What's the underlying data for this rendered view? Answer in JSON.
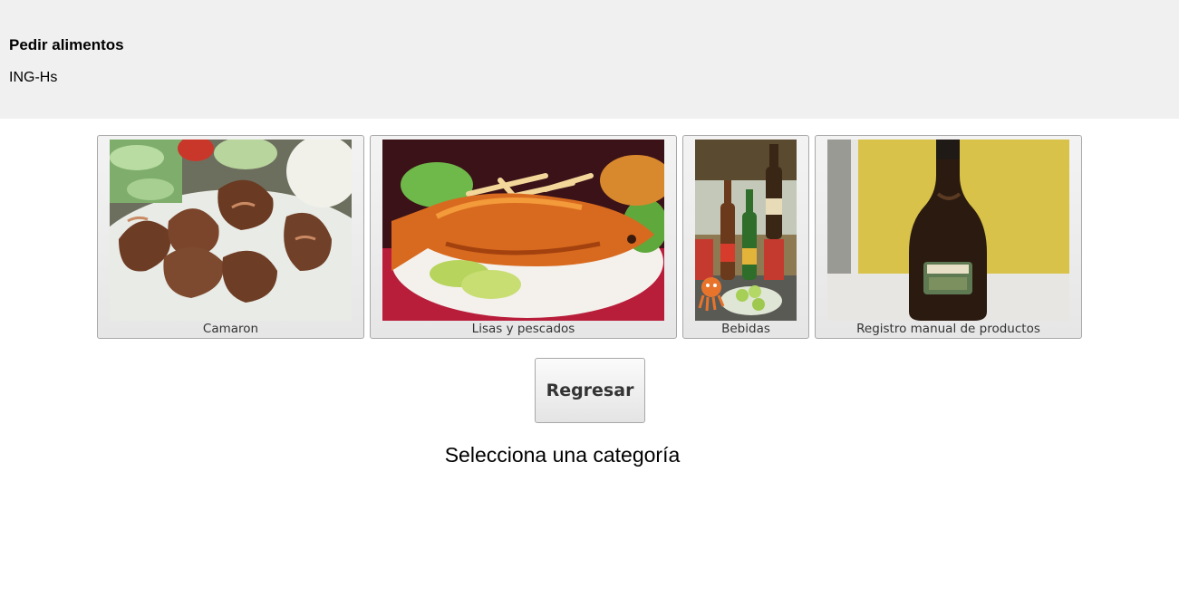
{
  "header": {
    "title": "Pedir alimentos",
    "subtitle": "ING-Hs"
  },
  "categories": [
    {
      "label": "Camaron",
      "image": "grilled-shrimp-plate"
    },
    {
      "label": "Lisas y pescados",
      "image": "fried-fish-plate"
    },
    {
      "label": "Bebidas",
      "image": "beer-bottles-and-limes"
    },
    {
      "label": "Registro manual de productos",
      "image": "baileys-bottle"
    }
  ],
  "actions": {
    "back_label": "Regresar"
  },
  "prompt": "Selecciona una categoría",
  "colors": {
    "header_bg": "#f0f0f0",
    "tile_border": "#a8a8a8",
    "tile_bg": "#ebebeb",
    "label_text": "#333333"
  }
}
